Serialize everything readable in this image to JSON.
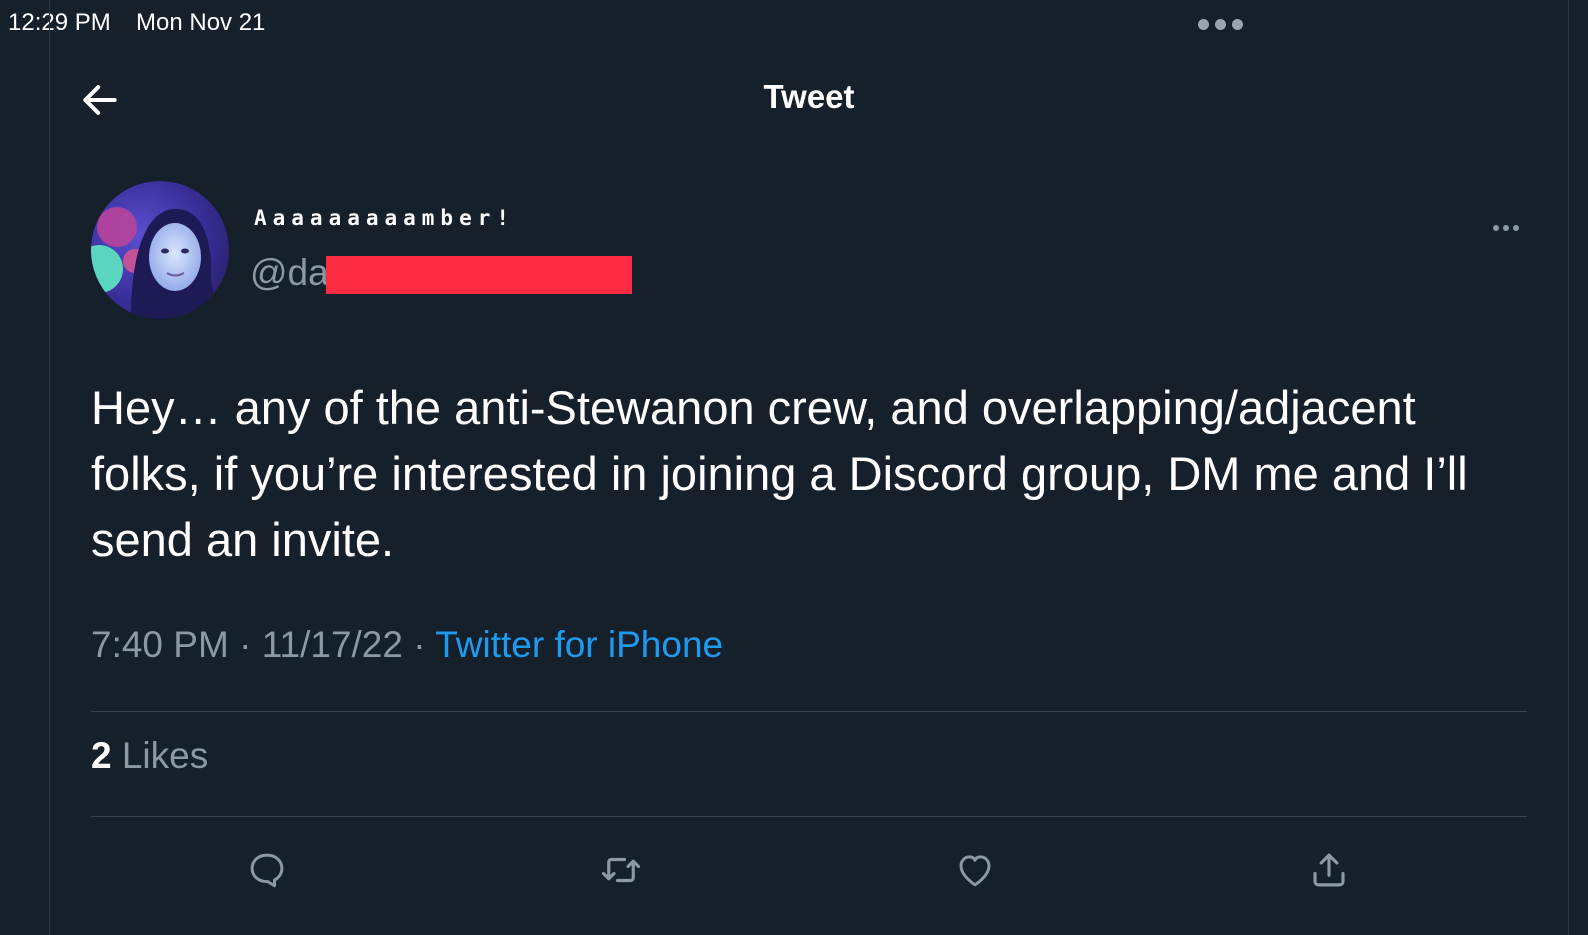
{
  "status_bar": {
    "time": "12:29 PM",
    "date": "Mon Nov 21"
  },
  "header": {
    "title": "Tweet",
    "back_icon": "arrow-left-icon"
  },
  "author": {
    "display_name": "Aaaaaaaaamber!",
    "handle": "@da",
    "avatar_icon": "profile-photo"
  },
  "tweet": {
    "text": "Hey… any of the anti-Stewanon crew, and overlapping/adjacent folks, if you’re interested in joining a Discord group, DM me and I’ll send an invite.",
    "time": "7:40 PM",
    "separator": "·",
    "date": "11/17/22",
    "source": "Twitter for iPhone"
  },
  "stats": {
    "likes_count": "2",
    "likes_label": "Likes"
  },
  "actions": [
    "reply-icon",
    "retweet-icon",
    "like-icon",
    "share-icon"
  ],
  "colors": {
    "background": "#15202b",
    "accent": "#1d9bf0",
    "muted": "#8b98a5",
    "redaction": "#fe2c43"
  }
}
